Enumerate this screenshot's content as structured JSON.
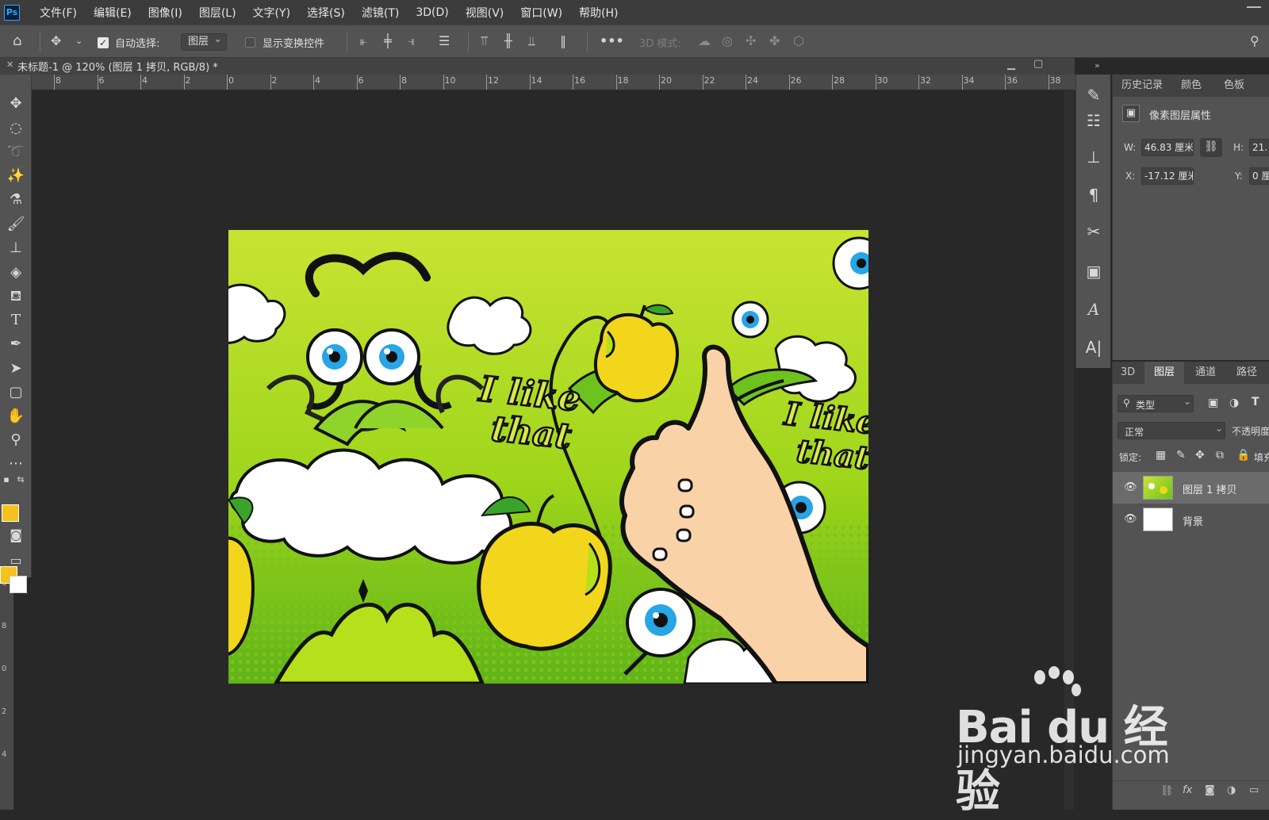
{
  "app": {
    "logo": "Ps",
    "menu": [
      "文件(F)",
      "编辑(E)",
      "图像(I)",
      "图层(L)",
      "文字(Y)",
      "选择(S)",
      "滤镜(T)",
      "3D(D)",
      "视图(V)",
      "窗口(W)",
      "帮助(H)"
    ]
  },
  "options": {
    "auto_select_label": "自动选择:",
    "auto_select_checked": true,
    "target_value": "图层",
    "show_transform_label": "显示变换控件",
    "mode3d_label": "3D 模式:",
    "more_label": "•••"
  },
  "document": {
    "title": "未标题-1 @ 120% (图层 1 拷贝, RGB/8) *",
    "close": "✕"
  },
  "ruler": {
    "ticks": [
      "8",
      "6",
      "4",
      "2",
      "0",
      "2",
      "4",
      "6",
      "8",
      "10",
      "12",
      "14",
      "16",
      "18",
      "20",
      "22",
      "24",
      "26",
      "28",
      "30",
      "32",
      "34",
      "36",
      "38"
    ],
    "vticks": [
      "6",
      "8",
      "0",
      "2",
      "4"
    ]
  },
  "colors": {
    "foreground": "#f5c21b",
    "background": "#ffffff"
  },
  "panels": {
    "top_tabs": [
      "历史记录",
      "颜色",
      "色板"
    ],
    "properties_title": "像素图层属性",
    "w_label": "W:",
    "w_value": "46.83 厘米",
    "h_label": "H:",
    "h_value": "21.",
    "x_label": "X:",
    "x_value": "-17.12 厘米",
    "y_label": "Y:",
    "y_value": "0 厘",
    "bottom_tabs": [
      "3D",
      "图层",
      "通道",
      "路径"
    ],
    "filter_kind": "类型",
    "blend_mode": "正常",
    "opacity_label": "不透明度",
    "lock_label": "锁定:",
    "fill_label": "填充",
    "layers": [
      {
        "name": "图层 1 拷贝",
        "selected": true
      },
      {
        "name": "背景",
        "selected": false
      }
    ]
  },
  "artwork": {
    "slogan_line1": "I like",
    "slogan_line2": "that"
  },
  "watermark": {
    "brand": "Bai du 经验",
    "url": "jingyan.baidu.com"
  }
}
